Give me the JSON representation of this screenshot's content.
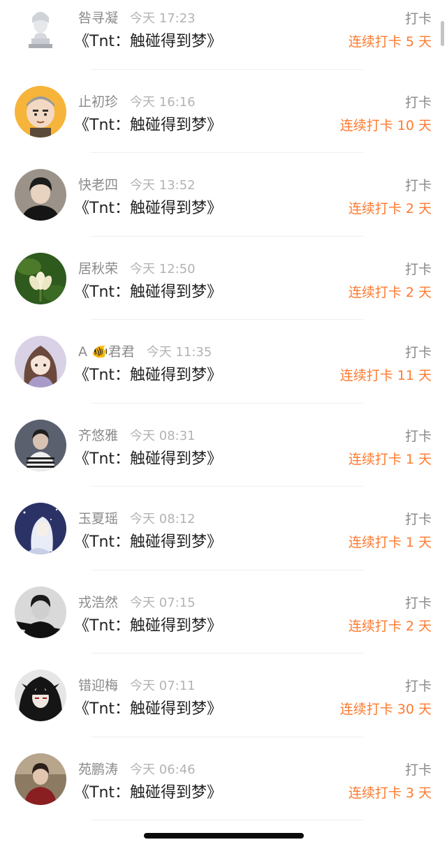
{
  "feed": {
    "rows": [
      {
        "name": "咎寻凝",
        "time": "今天 17:23",
        "title": "《Tnt：触碰得到梦》",
        "action": "打卡",
        "streak": "连续打卡 5 天",
        "avatar_icon": "bust-statue-icon",
        "avatar_bg": "#eef0f2"
      },
      {
        "name": "止初珍",
        "time": "今天 16:16",
        "title": "《Tnt：触碰得到梦》",
        "action": "打卡",
        "streak": "连续打卡 10 天",
        "avatar_icon": "cartoon-monk-icon",
        "avatar_bg": "#f6b53a"
      },
      {
        "name": "快老四",
        "time": "今天 13:52",
        "title": "《Tnt：触碰得到梦》",
        "action": "打卡",
        "streak": "连续打卡 2 天",
        "avatar_icon": "portrait-photo-icon",
        "avatar_bg": "#8e857b"
      },
      {
        "name": "居秋荣",
        "time": "今天 12:50",
        "title": "《Tnt：触碰得到梦》",
        "action": "打卡",
        "streak": "连续打卡 2 天",
        "avatar_icon": "lotus-flower-icon",
        "avatar_bg": "#2e5a1e"
      },
      {
        "name": "A 🐠君君",
        "time": "今天 11:35",
        "title": "《Tnt：触碰得到梦》",
        "action": "打卡",
        "streak": "连续打卡 11 天",
        "avatar_icon": "anime-girl-icon",
        "avatar_bg": "#cfc6dd"
      },
      {
        "name": "齐悠雅",
        "time": "今天 08:31",
        "title": "《Tnt：触碰得到梦》",
        "action": "打卡",
        "streak": "连续打卡 1 天",
        "avatar_icon": "portrait-photo-icon",
        "avatar_bg": "#4b5160"
      },
      {
        "name": "玉夏瑶",
        "time": "今天 08:12",
        "title": "《Tnt：触碰得到梦》",
        "action": "打卡",
        "streak": "连续打卡 1 天",
        "avatar_icon": "night-anime-icon",
        "avatar_bg": "#2b3266"
      },
      {
        "name": "戎浩然",
        "time": "今天 07:15",
        "title": "《Tnt：触碰得到梦》",
        "action": "打卡",
        "streak": "连续打卡 2 天",
        "avatar_icon": "portrait-photo-icon",
        "avatar_bg": "#5a5a5a"
      },
      {
        "name": "错迎梅",
        "time": "今天 07:11",
        "title": "《Tnt：触碰得到梦》",
        "action": "打卡",
        "streak": "连续打卡 30 天",
        "avatar_icon": "dark-anime-icon",
        "avatar_bg": "#2a2a2a"
      },
      {
        "name": "苑鹏涛",
        "time": "今天 06:46",
        "title": "《Tnt：触碰得到梦》",
        "action": "打卡",
        "streak": "连续打卡 3 天",
        "avatar_icon": "portrait-photo-icon",
        "avatar_bg": "#6e5a45"
      }
    ]
  },
  "colors": {
    "accent": "#ff7a2e",
    "secondary_text": "#8a8a8a",
    "primary_text": "#222222"
  }
}
